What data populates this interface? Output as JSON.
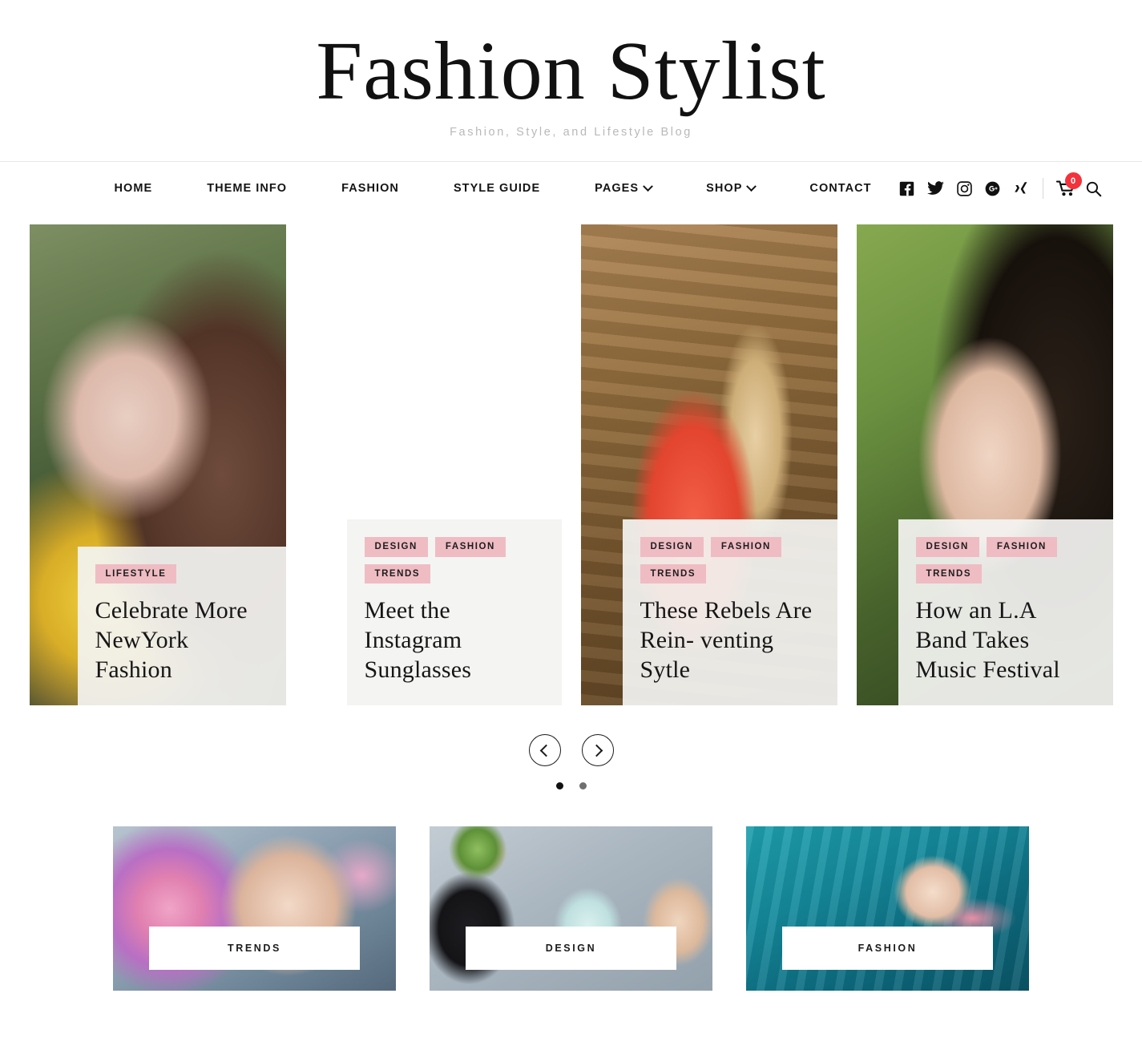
{
  "header": {
    "title": "Fashion Stylist",
    "tagline": "Fashion, Style, and Lifestyle Blog"
  },
  "nav": {
    "items": [
      {
        "label": "HOME",
        "has_dropdown": false
      },
      {
        "label": "THEME INFO",
        "has_dropdown": false
      },
      {
        "label": "FASHION",
        "has_dropdown": false
      },
      {
        "label": "STYLE GUIDE",
        "has_dropdown": false
      },
      {
        "label": "PAGES",
        "has_dropdown": true
      },
      {
        "label": "SHOP",
        "has_dropdown": true
      },
      {
        "label": "CONTACT",
        "has_dropdown": false
      }
    ],
    "social": [
      {
        "name": "facebook-icon"
      },
      {
        "name": "twitter-icon"
      },
      {
        "name": "instagram-icon"
      },
      {
        "name": "google-plus-icon"
      },
      {
        "name": "xing-icon"
      }
    ],
    "cart": {
      "count": "0",
      "badge_color": "#f4323c"
    },
    "search_icon": "search-icon"
  },
  "carousel": {
    "slides": [
      {
        "tags": [
          "LIFESTYLE"
        ],
        "title": "Celebrate More NewYork Fashion",
        "photo": "ph1"
      },
      {
        "tags": [
          "DESIGN",
          "FASHION",
          "TRENDS"
        ],
        "title": "Meet the Instagram Sunglasses",
        "photo": "ph2"
      },
      {
        "tags": [
          "DESIGN",
          "FASHION",
          "TRENDS"
        ],
        "title": "These Rebels Are Rein- venting Sytle",
        "photo": "ph3"
      },
      {
        "tags": [
          "DESIGN",
          "FASHION",
          "TRENDS"
        ],
        "title": "How an L.A Band Takes Music Festival",
        "photo": "ph4"
      }
    ],
    "prev_label": "Previous slide",
    "next_label": "Next slide",
    "dots": [
      {
        "active": true
      },
      {
        "active": false
      }
    ]
  },
  "categories": [
    {
      "label": "TRENDS",
      "photo": "ph5"
    },
    {
      "label": "DESIGN",
      "photo": "ph6"
    },
    {
      "label": "FASHION",
      "photo": "ph7"
    }
  ],
  "colors": {
    "tag_pink": "#efbcc3",
    "cart_badge_red": "#f4323c",
    "text_dark": "#161616",
    "tagline_gray": "#b9b9b9",
    "card_panel": "#f3f3f1"
  }
}
